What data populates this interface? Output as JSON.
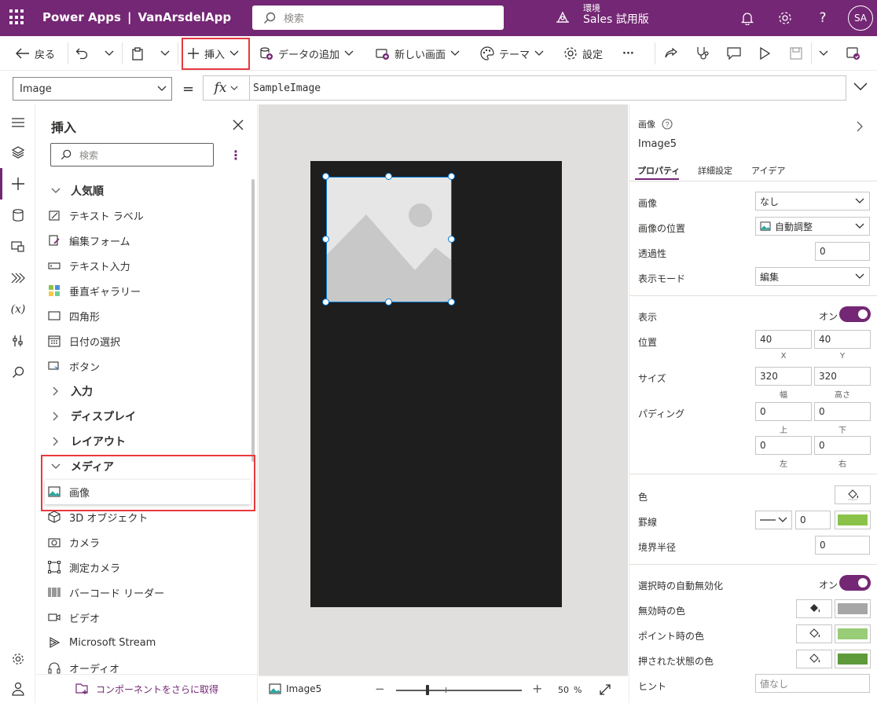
{
  "topbar": {
    "app_name": "Power Apps",
    "separator": "|",
    "app_title": "VanArsdelApp",
    "search_placeholder": "検索",
    "env_label": "環境",
    "env_name": "Sales 試用版",
    "help": "?",
    "avatar_initials": "SA"
  },
  "commandbar": {
    "back": "戻る",
    "insert": "挿入",
    "add_data": "データの追加",
    "new_screen": "新しい画面",
    "theme": "テーマ",
    "settings": "設定",
    "more": "···"
  },
  "formulabar": {
    "property": "Image",
    "equals": "=",
    "fx": "fx",
    "formula": "SampleImage"
  },
  "insert_pane": {
    "title": "挿入",
    "search_placeholder": "検索",
    "popular_header": "人気順",
    "popular_items": [
      "テキスト ラベル",
      "編集フォーム",
      "テキスト入力",
      "垂直ギャラリー",
      "四角形",
      "日付の選択",
      "ボタン"
    ],
    "categories": [
      "入力",
      "ディスプレイ",
      "レイアウト"
    ],
    "media_header": "メディア",
    "media_items": [
      "画像",
      "3D オブジェクト",
      "カメラ",
      "測定カメラ",
      "バーコード リーダー",
      "ビデオ",
      "Microsoft Stream",
      "オーディオ"
    ],
    "get_more": "コンポーネントをさらに取得"
  },
  "statusbar": {
    "screen_name": "Image5",
    "minus": "−",
    "plus": "+",
    "zoom": "50",
    "percent": "%",
    "zoom_level": 0.5
  },
  "properties": {
    "type_label": "画像",
    "control_name": "Image5",
    "tabs": [
      "プロパティ",
      "詳細設定",
      "アイデア"
    ],
    "image_label": "画像",
    "image_value": "なし",
    "image_position_label": "画像の位置",
    "image_position_value": "自動調整",
    "transparency_label": "透過性",
    "transparency_value": "0",
    "display_mode_label": "表示モード",
    "display_mode_value": "編集",
    "visible_label": "表示",
    "on_label": "オン",
    "position_label": "位置",
    "x_value": "40",
    "y_value": "40",
    "x_label": "X",
    "y_label": "Y",
    "size_label": "サイズ",
    "width_value": "320",
    "height_value": "320",
    "width_label": "幅",
    "height_label": "高さ",
    "padding_label": "パディング",
    "padding_top": "0",
    "padding_bottom": "0",
    "padding_left": "0",
    "padding_right": "0",
    "top_label": "上",
    "bottom_label": "下",
    "left_label": "左",
    "right_label": "右",
    "color_label": "色",
    "border_label": "罫線",
    "border_value": "0",
    "border_radius_label": "境界半径",
    "border_radius_value": "0",
    "auto_disable_label": "選択時の自動無効化",
    "disabled_color_label": "無効時の色",
    "hover_color_label": "ポイント時の色",
    "pressed_color_label": "押された状態の色",
    "tooltip_label": "ヒント",
    "tooltip_placeholder": "値なし"
  },
  "colors": {
    "brand": "#742774",
    "highlight": "#e8393f",
    "selection": "#0078d4",
    "border_color": "#8bc34a",
    "disabled_color": "#a6a6a6",
    "hover_color": "#99cc77",
    "pressed_color": "#5e9a3a"
  }
}
